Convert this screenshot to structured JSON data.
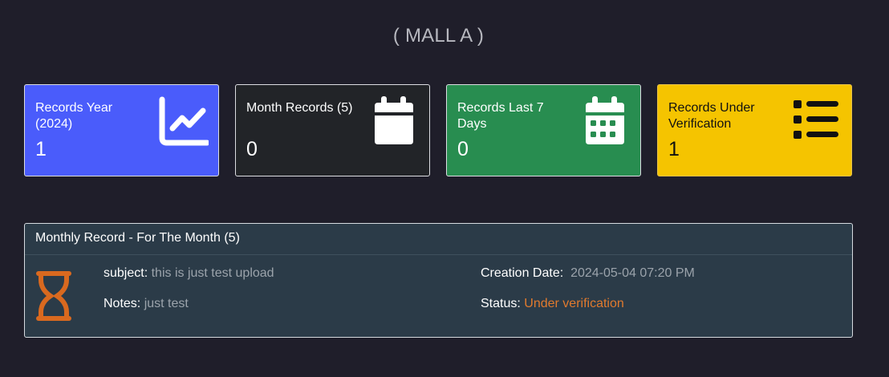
{
  "page": {
    "title": "( MALL A )"
  },
  "cards": [
    {
      "label": "Records Year (2024)",
      "value": "1",
      "icon": "chart-line-icon",
      "color": "#4a5cfb"
    },
    {
      "label": "Month Records (5)",
      "value": "0",
      "icon": "calendar-icon",
      "color": "#222428"
    },
    {
      "label": "Records Last 7 Days",
      "value": "0",
      "icon": "calendar-days-icon",
      "color": "#288d50"
    },
    {
      "label": "Records Under Verification",
      "value": "1",
      "icon": "list-icon",
      "color": "#f5c400"
    }
  ],
  "monthly_panel": {
    "title": "Monthly Record - For The Month (5)",
    "status_icon": "hourglass-icon",
    "subject_label": "subject:",
    "subject_value": "this is just test upload",
    "notes_label": "Notes:",
    "notes_value": "just test",
    "date_label": "Creation Date:",
    "date_value": "2024-05-04 07:20 PM",
    "status_label": "Status:",
    "status_value": "Under verification",
    "status_color": "#e07a2e"
  }
}
